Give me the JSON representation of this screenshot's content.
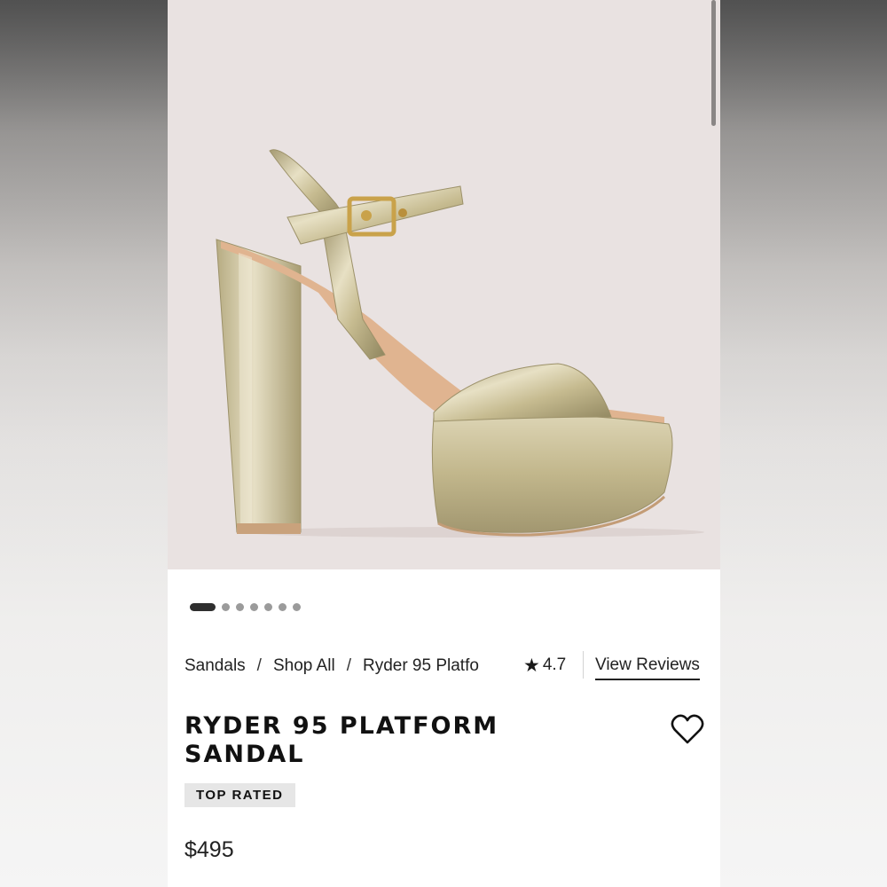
{
  "product_image": {
    "alt": "Gold metallic platform sandal with ankle strap"
  },
  "carousel": {
    "total": 7,
    "active": 0
  },
  "breadcrumb": {
    "items": [
      "Sandals",
      "Shop All",
      "Ryder 95 Platfo"
    ],
    "separator": "/"
  },
  "rating": {
    "icon": "star-icon",
    "value": "4.7"
  },
  "reviews_link": "View Reviews",
  "product": {
    "title_line1": "RYDER 95 PLATFORM",
    "title_line2": "SANDAL",
    "badge": "TOP RATED",
    "price": "$495"
  },
  "icons": {
    "favorite": "heart-icon"
  },
  "colors": {
    "hero_bg": "#e9e2e1",
    "gold": "#c9bf94",
    "text": "#111111",
    "badge_bg": "#e6e6e6"
  }
}
